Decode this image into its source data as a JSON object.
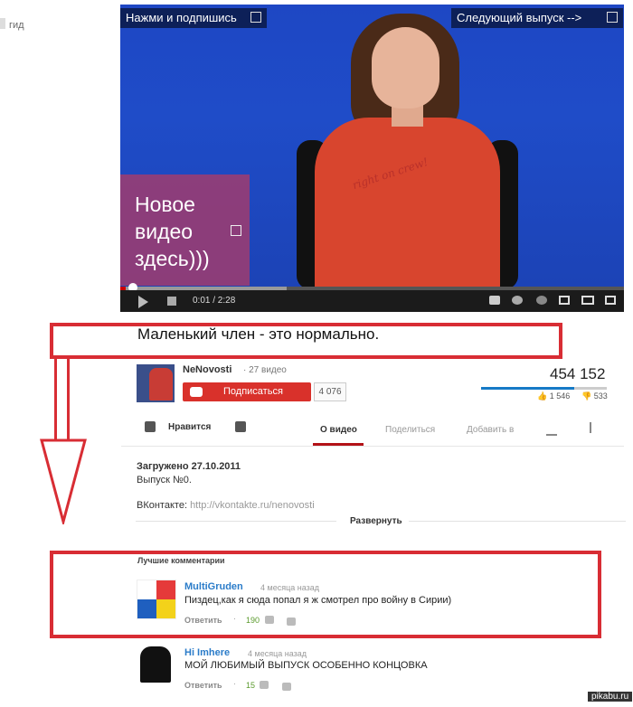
{
  "guide": {
    "label": "гид"
  },
  "player": {
    "annotation_subscribe": "Нажми и подпишись",
    "annotation_next": "Следующий выпуск -->",
    "annotation_new_video": "Новое видео здесь)))",
    "shirt_text": "right on crew!",
    "time": "0:01 / 2:28",
    "progress_played": 0.01,
    "progress_buffered": 0.33
  },
  "video": {
    "title": "Маленький член - это нормально.",
    "channel": "NeNovosti",
    "video_count": "· 27 видео",
    "subscribe": "Подписаться",
    "subscribers": "4 076",
    "views": "454 152",
    "likes": "1 546",
    "dislikes": "533",
    "like_ratio": 0.74
  },
  "actions": {
    "like": "Нравится",
    "tab_about": "О видео",
    "tab_share": "Поделиться",
    "tab_add": "Добавить в"
  },
  "description": {
    "uploaded": "Загружено 27.10.2011",
    "episode": "Выпуск №0.",
    "vk_label": "ВКонтакте:",
    "vk_link": "http://vkontakte.ru/nenovosti",
    "expand": "Развернуть"
  },
  "comments": {
    "heading": "Лучшие комментарии",
    "items": [
      {
        "author": "MultiGruden",
        "date": "4 месяца назад",
        "text": "Пиздец,как я сюда попал я ж смотрел про войну в Сирии)",
        "reply": "Ответить",
        "likes": "190"
      },
      {
        "author": "Hi Imhere",
        "date": "4 месяца назад",
        "text": "МОЙ ЛЮБИМЫЙ ВЫПУСК ОСОБЕННО КОНЦОВКА",
        "reply": "Ответить",
        "likes": "15"
      }
    ]
  },
  "watermark": "pikabu.ru",
  "colors": {
    "accent_red": "#d82d34",
    "subscribe_red": "#d9312b",
    "link_blue": "#2b7cc9"
  }
}
